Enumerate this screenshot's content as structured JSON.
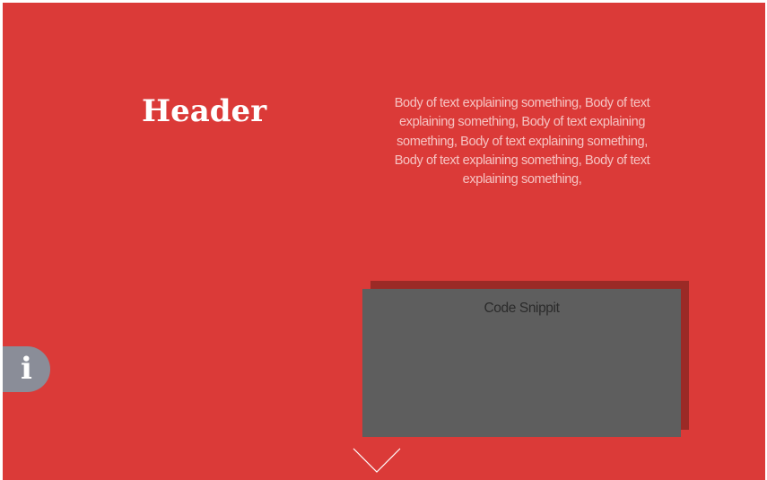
{
  "header": {
    "title": "Header"
  },
  "body": {
    "text": "Body of text explaining something, Body of text explaining something, Body of text explaining something, Body of text explaining something, Body of text explaining something, Body of text explaining something,"
  },
  "snippet": {
    "label": "Code Snippit"
  },
  "info_button": {
    "glyph": "i",
    "icon": "info-icon"
  },
  "scroll_indicator": {
    "icon": "chevron-down-icon"
  },
  "colors": {
    "background": "#db3a38",
    "body_text": "#f6c3c2",
    "snippet_box": "#5e5e5e",
    "snippet_shadow": "#9b2a26",
    "info_tab": "#8a8d98"
  }
}
